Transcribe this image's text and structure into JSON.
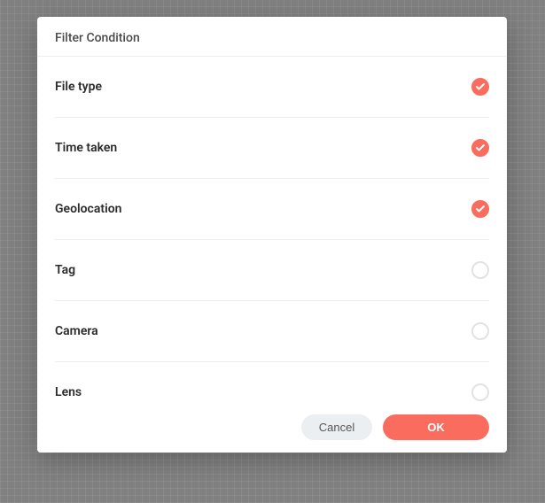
{
  "dialog": {
    "title": "Filter Condition",
    "buttons": {
      "cancel": "Cancel",
      "ok": "OK"
    }
  },
  "filters": [
    {
      "label": "File type",
      "checked": true
    },
    {
      "label": "Time taken",
      "checked": true
    },
    {
      "label": "Geolocation",
      "checked": true
    },
    {
      "label": "Tag",
      "checked": false
    },
    {
      "label": "Camera",
      "checked": false
    },
    {
      "label": "Lens",
      "checked": false
    }
  ]
}
